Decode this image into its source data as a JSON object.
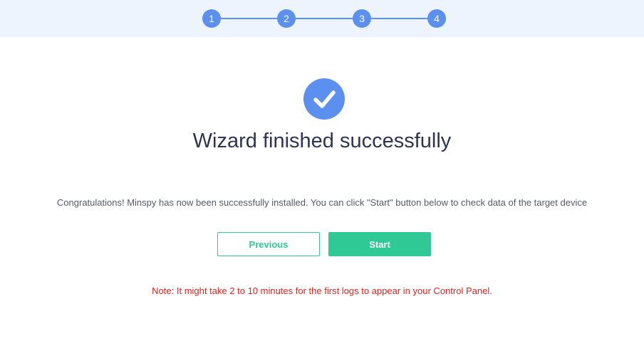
{
  "stepper": {
    "steps": [
      {
        "label": "1"
      },
      {
        "label": "2"
      },
      {
        "label": "3"
      },
      {
        "label": "4"
      }
    ],
    "current_step": 4,
    "active_color": "#5b8ff0"
  },
  "status_icon": "checkmark-circle-icon",
  "title": "Wizard finished successfully",
  "message": "Congratulations! Minspy has now been successfully installed. You can click \"Start\" button below to check data of the target device",
  "buttons": {
    "previous_label": "Previous",
    "start_label": "Start"
  },
  "note": "Note: It might take 2 to 10 minutes for the first logs to appear in your Control Panel.",
  "colors": {
    "primary_blue": "#5b8ff0",
    "success_green": "#2ec995",
    "note_red": "#e0231c",
    "header_bg": "#edf4fd"
  }
}
